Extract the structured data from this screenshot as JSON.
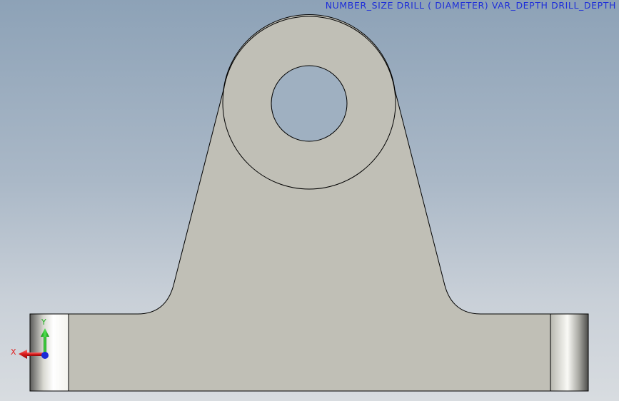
{
  "annotation": {
    "text": "NUMBER_SIZE DRILL ( DIAMETER) VAR_DEPTH DRILL_DEPTH"
  },
  "triad": {
    "x_label": "X",
    "y_label": "Y"
  },
  "colors": {
    "annotation": "#1f2fd8",
    "part_face": "#c0bfb6",
    "part_edge": "#000000",
    "axis_x": "#e02020",
    "axis_y": "#22b022",
    "axis_z": "#1a2bd6"
  }
}
